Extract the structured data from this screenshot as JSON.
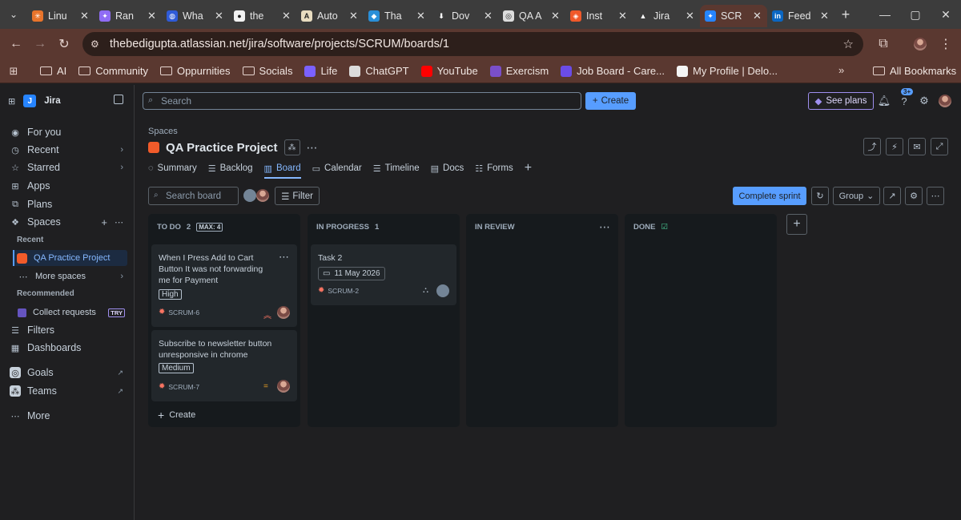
{
  "browser": {
    "tabs": [
      {
        "label": "Linu",
        "color": "#e8742b",
        "glyph": "✳"
      },
      {
        "label": "Ran",
        "color": "#8f6cf5",
        "glyph": "✦"
      },
      {
        "label": "Wha",
        "color": "#2f5bd8",
        "glyph": "◍"
      },
      {
        "label": "the",
        "color": "#f2f2f2",
        "glyph": "●"
      },
      {
        "label": "Auto",
        "color": "#e8dcc0",
        "glyph": "A"
      },
      {
        "label": "Tha",
        "color": "#2a8fd8",
        "glyph": "◆"
      },
      {
        "label": "Dov",
        "color": "#3c3c3c",
        "glyph": "⬇"
      },
      {
        "label": "QA A",
        "color": "#dcdcdc",
        "glyph": "◎"
      },
      {
        "label": "Inst",
        "color": "#f0592a",
        "glyph": "◈"
      },
      {
        "label": "Jira",
        "color": "#3c3c3c",
        "glyph": "▲"
      },
      {
        "label": "SCR",
        "color": "#2684ff",
        "glyph": "✦"
      },
      {
        "label": "Feed",
        "color": "#0a66c2",
        "glyph": "in"
      }
    ],
    "url": "thebedigupta.atlassian.net/jira/software/projects/SCRUM/boards/1",
    "bookmarks": [
      {
        "label": "AI",
        "type": "folder"
      },
      {
        "label": "Community",
        "type": "folder"
      },
      {
        "label": "Oppurnities",
        "type": "folder"
      },
      {
        "label": "Socials",
        "type": "folder"
      },
      {
        "label": "Life",
        "type": "icon",
        "color": "#7b61ff"
      },
      {
        "label": "ChatGPT",
        "type": "icon",
        "color": "#dcdcdc"
      },
      {
        "label": "YouTube",
        "type": "icon",
        "color": "#ff0000"
      },
      {
        "label": "Exercism",
        "type": "icon",
        "color": "#7a4fc9"
      },
      {
        "label": "Job Board - Care...",
        "type": "icon",
        "color": "#6b4ce6"
      },
      {
        "label": "My Profile | Delo...",
        "type": "icon",
        "color": "#f5f5f5"
      }
    ],
    "all_bookmarks": "All Bookmarks"
  },
  "sidebar": {
    "app_name": "Jira",
    "items": [
      {
        "label": "For you",
        "icon": "user-circle"
      },
      {
        "label": "Recent",
        "icon": "clock"
      },
      {
        "label": "Starred",
        "icon": "star"
      },
      {
        "label": "Apps",
        "icon": "grid"
      },
      {
        "label": "Plans",
        "icon": "plans"
      },
      {
        "label": "Spaces",
        "icon": "spaces"
      }
    ],
    "recent_heading": "Recent",
    "recent_project": "QA Practice Project",
    "more_spaces": "More spaces",
    "recommended_heading": "Recommended",
    "collect_requests": "Collect requests",
    "try_badge": "TRY",
    "filters": "Filters",
    "dashboards": "Dashboards",
    "goals": "Goals",
    "teams": "Teams",
    "more": "More"
  },
  "topnav": {
    "search_placeholder": "Search",
    "create_label": "Create",
    "see_plans_label": "See plans",
    "notif_badge": "3+"
  },
  "project": {
    "breadcrumb": "Spaces",
    "title": "QA Practice Project",
    "tabs": [
      {
        "label": "Summary",
        "icon": "summary"
      },
      {
        "label": "Backlog",
        "icon": "backlog"
      },
      {
        "label": "Board",
        "icon": "board"
      },
      {
        "label": "Calendar",
        "icon": "calendar"
      },
      {
        "label": "Timeline",
        "icon": "timeline"
      },
      {
        "label": "Docs",
        "icon": "docs"
      },
      {
        "label": "Forms",
        "icon": "forms"
      }
    ]
  },
  "board": {
    "search_placeholder": "Search board",
    "filter_label": "Filter",
    "complete_sprint": "Complete sprint",
    "group_label": "Group",
    "columns": [
      {
        "name": "TO DO",
        "count": "2",
        "max": "MAX: 4"
      },
      {
        "name": "IN PROGRESS",
        "count": "1"
      },
      {
        "name": "IN REVIEW",
        "count": ""
      },
      {
        "name": "DONE",
        "count": ""
      }
    ],
    "cards": [
      {
        "title": "When I Press Add to Cart Button It was not forwarding me for Payment",
        "priority_tag": "High",
        "key": "SCRUM-6",
        "priority_color": "#f87462"
      },
      {
        "title": "Subscribe to newsletter button unresponsive in chrome",
        "priority_tag": "Medium",
        "key": "SCRUM-7",
        "priority_color": "#f5a623"
      },
      {
        "title": "Task 2",
        "date": "11 May 2026",
        "key": "SCRUM-2"
      }
    ],
    "create_label": "Create"
  }
}
